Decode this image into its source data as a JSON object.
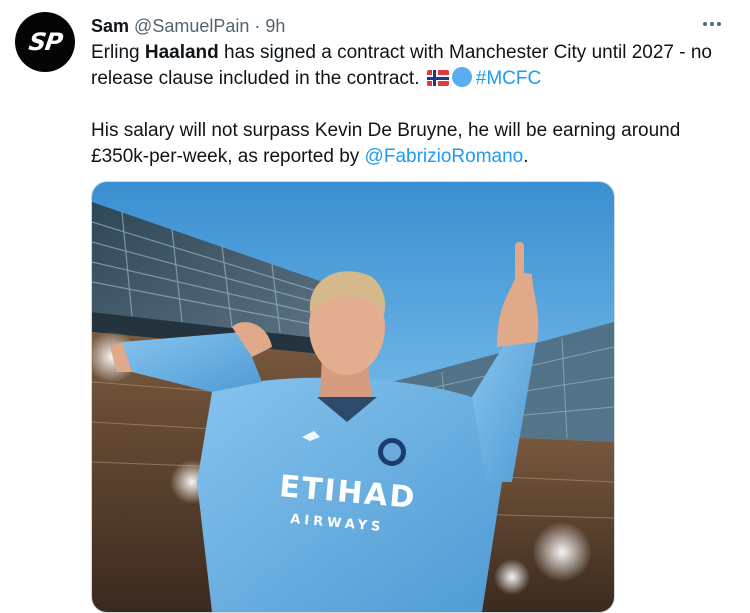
{
  "tweet": {
    "avatar_text": "SP",
    "author_name": "Sam",
    "author_handle": "@SamuelPain",
    "separator": "·",
    "timestamp": "9h",
    "text": {
      "p1_part1": "Erling ",
      "p1_bold": "Haaland",
      "p1_part2": " has signed a contract with Manchester City until 2027 - no release clause included in the contract. ",
      "hashtag": "#MCFC",
      "p2_part1": "His salary will not surpass Kevin De Bruyne, he will be earning around £350k-per-week, as reported by ",
      "mention": "@FabrizioRomano",
      "p2_part2": "."
    },
    "media": {
      "shirt_sponsor": "ETIHAD",
      "shirt_sponsor_sub": "AIRWAYS"
    }
  },
  "colors": {
    "link": "#1d9bf0",
    "muted": "#536471",
    "shirt": "#6cabdd",
    "sky": "#4f9fd6"
  },
  "icons": {
    "more": "more-horizontal-icon",
    "flag": "norway-flag-emoji",
    "circle": "blue-circle-emoji"
  }
}
